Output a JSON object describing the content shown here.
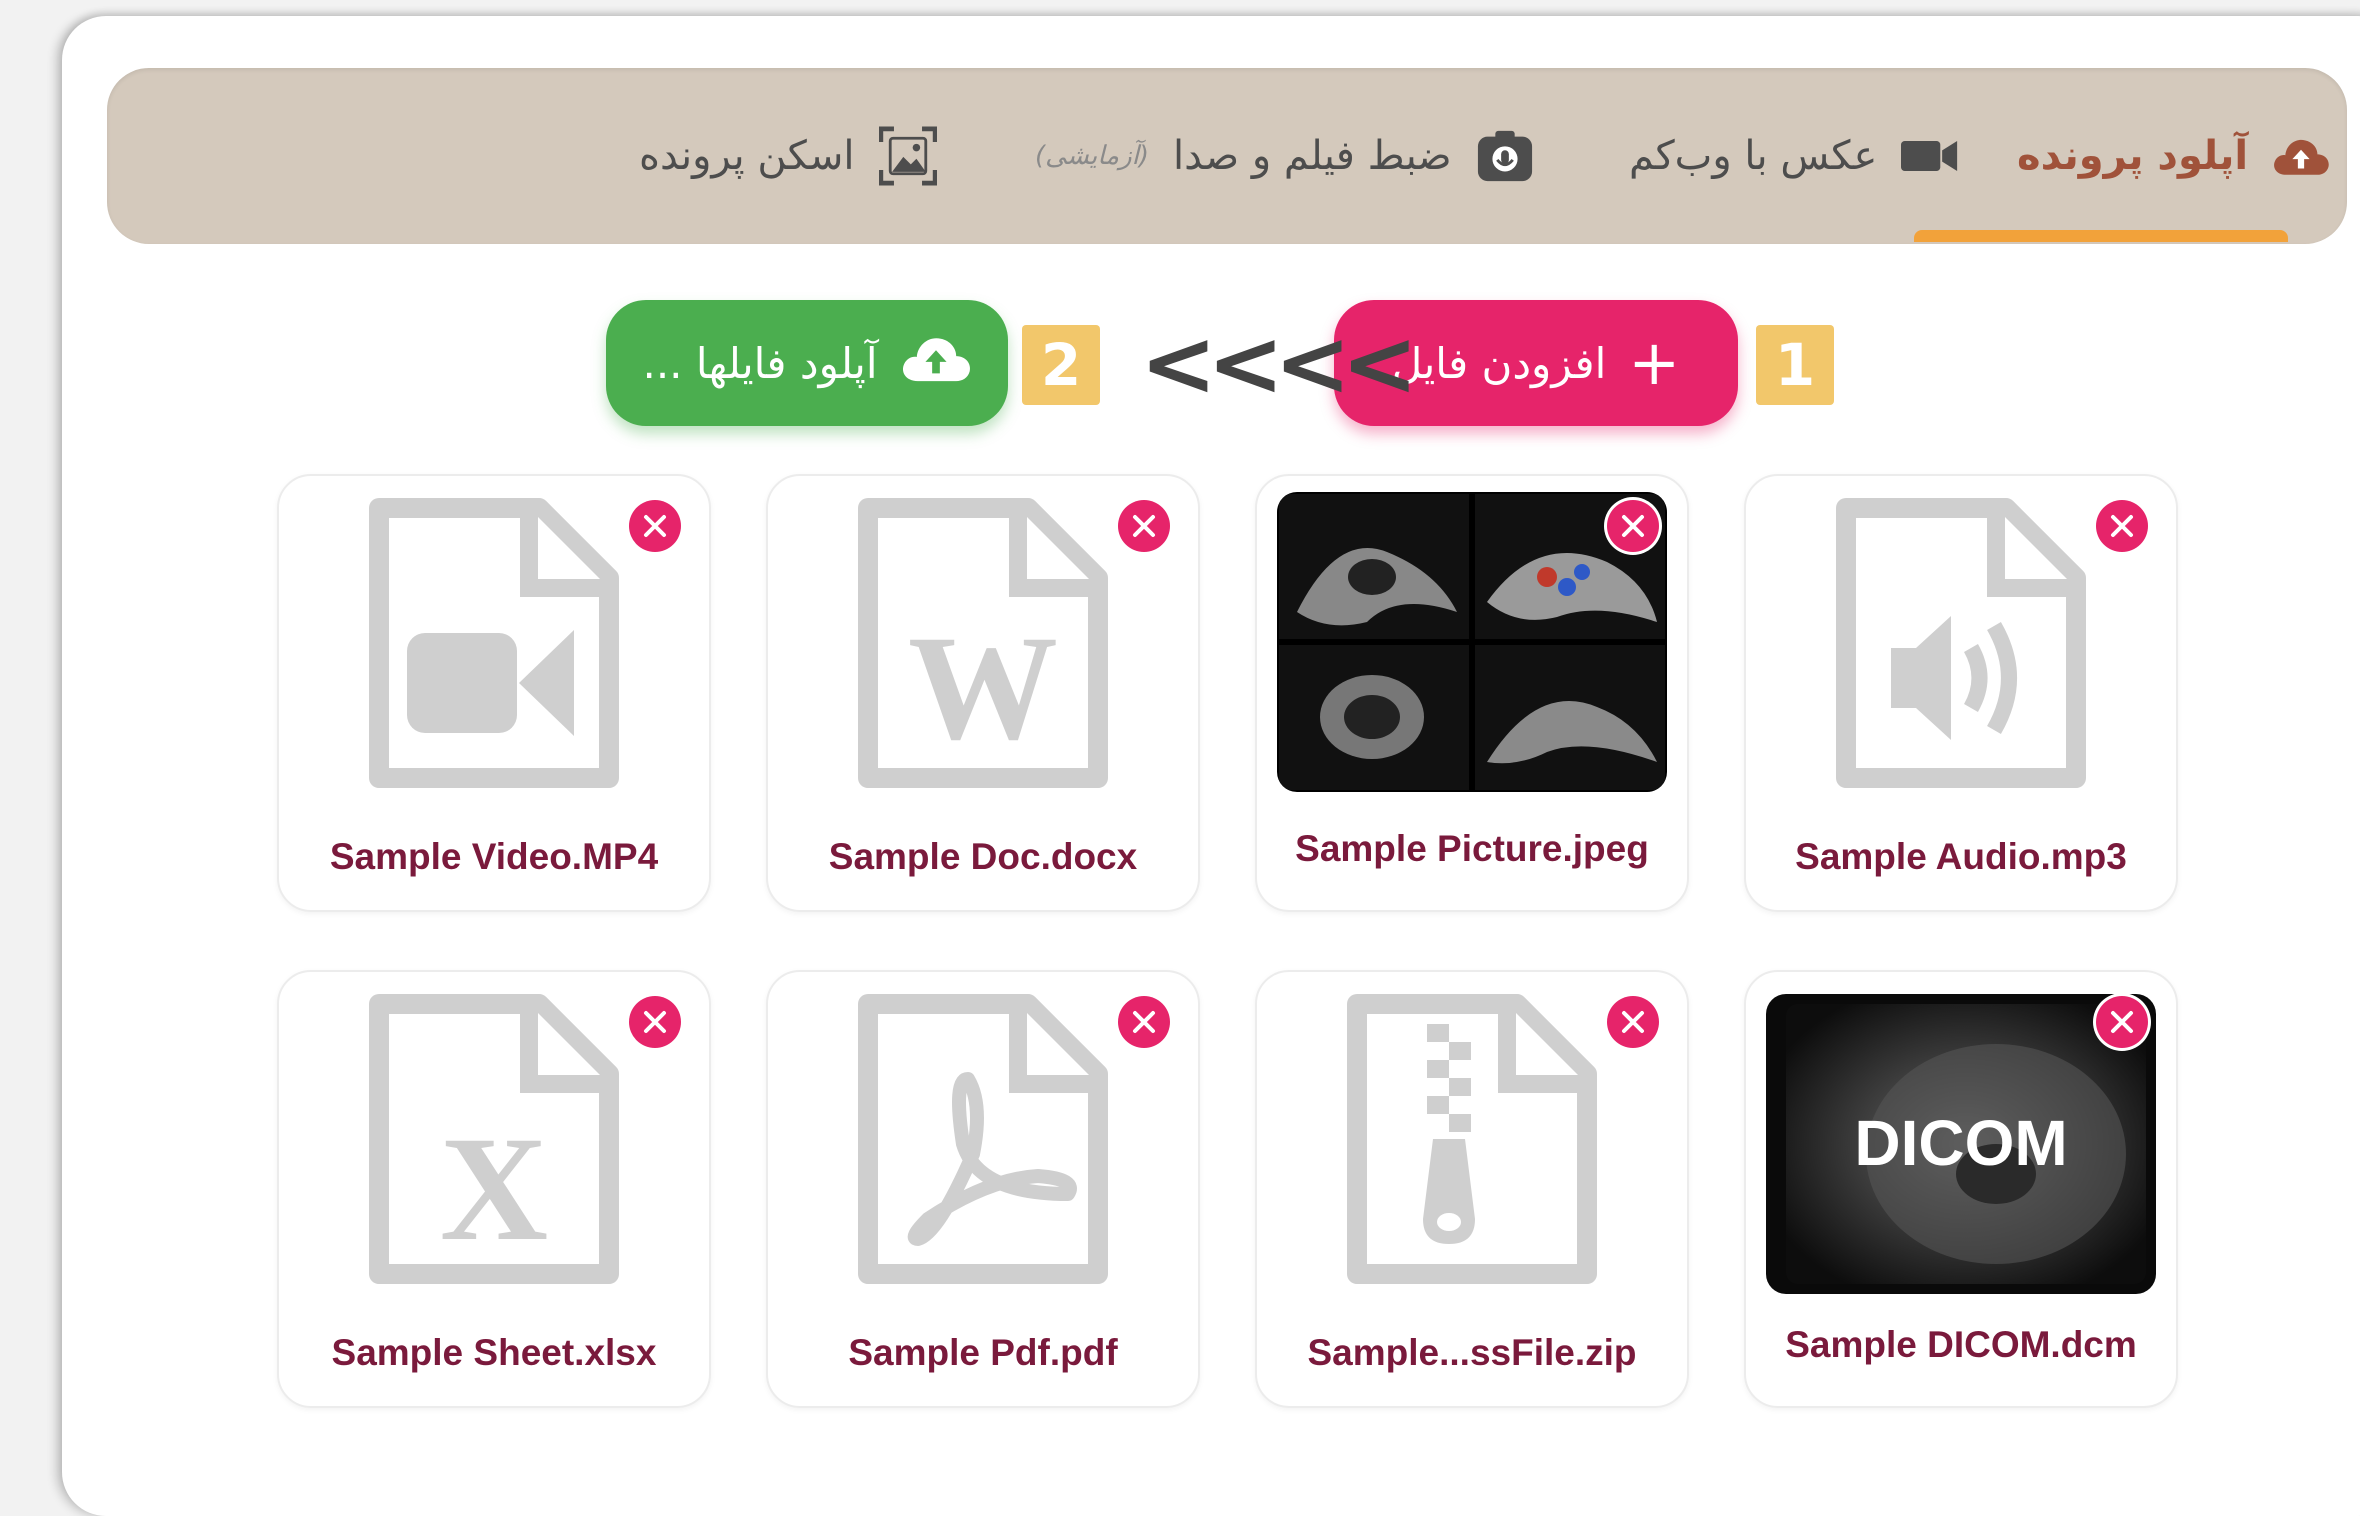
{
  "tabs": {
    "upload": "آپلود پرونده",
    "webcam": "عکس با وب‌کم",
    "record": "ضبط فیلم و صدا",
    "record_note": "(آزمایشی)",
    "scan": "اسکن پرونده"
  },
  "steps": {
    "step1": "1",
    "step2": "2",
    "arrows": "<<<<"
  },
  "actions": {
    "add_file": "افزودن فایل",
    "upload_files": "آپلود فایلها ..."
  },
  "files": [
    {
      "name": "Sample Audio.mp3",
      "icon": "audio-file-icon"
    },
    {
      "name": "Sample Picture.jpeg",
      "icon": "image-thumbnail"
    },
    {
      "name": "Sample Doc.docx",
      "icon": "word-file-icon"
    },
    {
      "name": "Sample Video.MP4",
      "icon": "video-file-icon"
    },
    {
      "name": "Sample DICOM.dcm",
      "icon": "dicom-thumbnail",
      "thumb_text": "DICOM"
    },
    {
      "name": "Sample...ssFile.zip",
      "icon": "zip-file-icon"
    },
    {
      "name": "Sample Pdf.pdf",
      "icon": "pdf-file-icon"
    },
    {
      "name": "Sample Sheet.xlsx",
      "icon": "excel-file-icon"
    }
  ],
  "colors": {
    "accent_pink": "#e6246a",
    "accent_green": "#4bae4f",
    "step_yellow": "#f2c76b",
    "tab_bar": "#d4c9bc",
    "active_tab": "#a0523a",
    "file_name": "#7a1a3c"
  }
}
